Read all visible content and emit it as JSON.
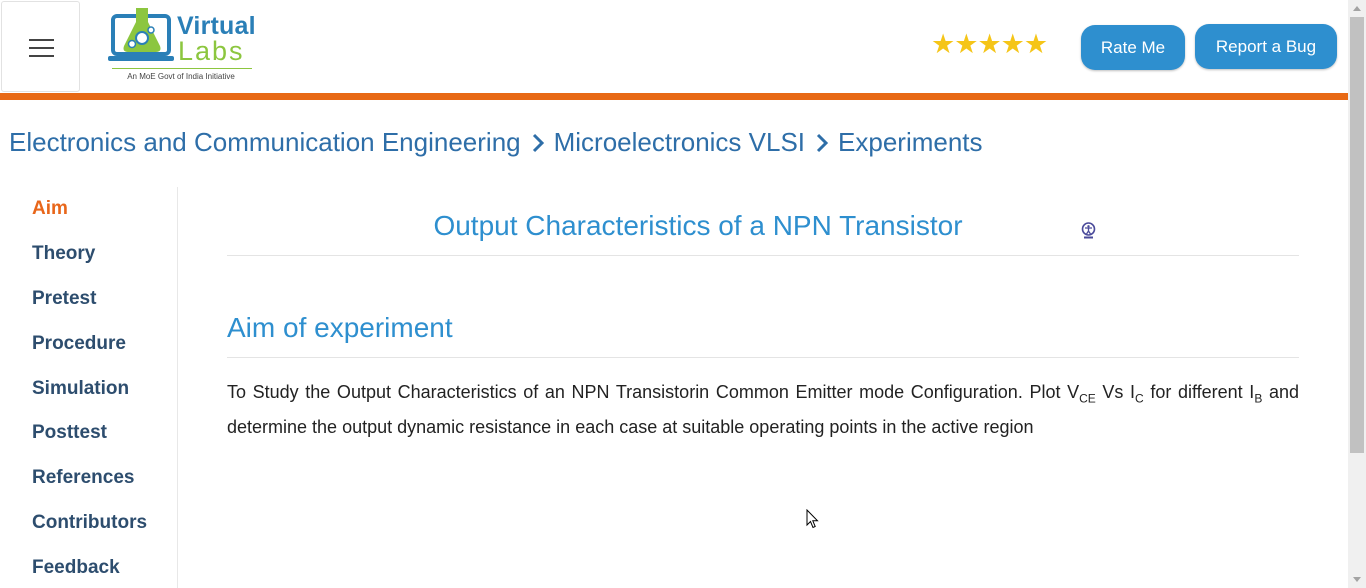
{
  "header": {
    "menu_icon": "hamburger-menu-icon",
    "logo": {
      "line1": "Virtual",
      "line2": "Labs",
      "tagline": "An MoE Govt of India Initiative"
    },
    "rating": {
      "stars": 5,
      "max": 5,
      "color": "#f5c518"
    },
    "rate_button": "Rate Me",
    "report_button": "Report a Bug"
  },
  "breadcrumb": {
    "items": [
      "Electronics and Communication Engineering",
      "Microelectronics VLSI",
      "Experiments"
    ],
    "separator_icon": "chevron-right-icon"
  },
  "sidebar": {
    "items": [
      "Aim",
      "Theory",
      "Pretest",
      "Procedure",
      "Simulation",
      "Posttest",
      "References",
      "Contributors",
      "Feedback"
    ],
    "active": "Aim"
  },
  "main": {
    "title": "Output Characteristics of a NPN Transistor",
    "title_icon": "accessibility-icon",
    "section_title": "Aim of experiment",
    "aim": {
      "part1": "To Study the Output Characteristics of an NPN Transistorin Common Emitter mode Configuration. Plot V",
      "sub1": "CE",
      "part2": " Vs I",
      "sub2": "C",
      "part3": " for different I",
      "sub3": "B",
      "part4": " and determine the output dynamic resistance in each case at suitable operating points in the active region"
    }
  },
  "colors": {
    "accent": "#2e8fcf",
    "orange": "#e86915",
    "active_nav": "#e8661a",
    "nav": "#2d4d6e"
  }
}
